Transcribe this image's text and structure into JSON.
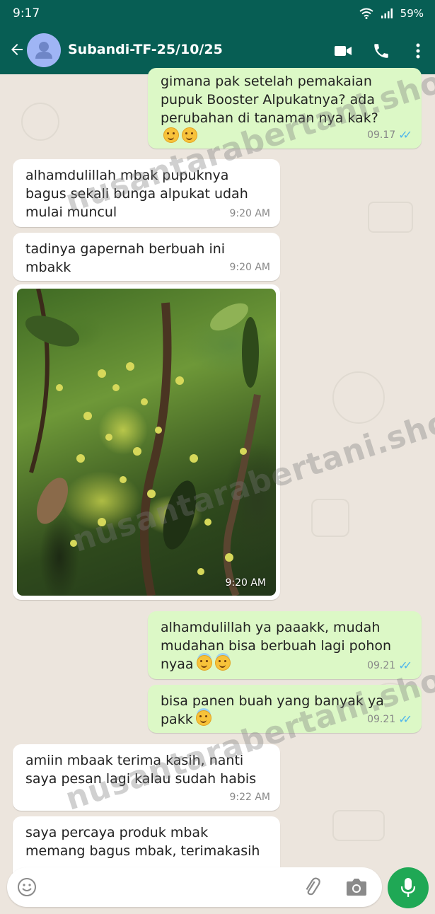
{
  "status": {
    "time": "9:17",
    "battery": "59%"
  },
  "header": {
    "contact_name": "Subandi-TF-25/10/25"
  },
  "messages": [
    {
      "text": "gimana pak setelah pemakaian\npupuk Booster Alpukatnya? ada\nperubahan di tanaman nya kak?",
      "time": "09.17"
    },
    {
      "text": "alhamdulillah mbak pupuknya\nbagus sekali bunga alpukat udah\nmulai muncul",
      "time": "9:20 AM"
    },
    {
      "text": "tadinya gapernah berbuah ini\nmbakk",
      "time": "9:20 AM"
    },
    {
      "text": "",
      "time": "9:20 AM"
    },
    {
      "text": "alhamdulillah ya paaakk, mudah\nmudahan bisa berbuah lagi pohon\nnyaa",
      "time": "09.21"
    },
    {
      "text": "bisa panen buah yang banyak ya\npakk",
      "time": "09.21"
    },
    {
      "text": "amiin mbaak terima kasih, nanti\nsaya pesan lagi kalau sudah habis",
      "time": "9:22 AM"
    },
    {
      "text": "saya percaya produk mbak\nmemang bagus mbak, terimakasih",
      "time": ""
    }
  ],
  "watermark": "nusantarabertani.shop",
  "icons": [
    "back-arrow-icon",
    "avatar-person-icon",
    "video-call-icon",
    "phone-icon",
    "more-vert-icon",
    "emoji-icon",
    "attach-icon",
    "camera-icon",
    "mic-icon",
    "wifi-icon",
    "signal-icon"
  ],
  "colors": {
    "header": "#075E54",
    "outgoing": "#DCF8C6",
    "incoming": "#FFFFFF",
    "mic": "#1FA855",
    "read_ticks": "#4FB6EC"
  }
}
